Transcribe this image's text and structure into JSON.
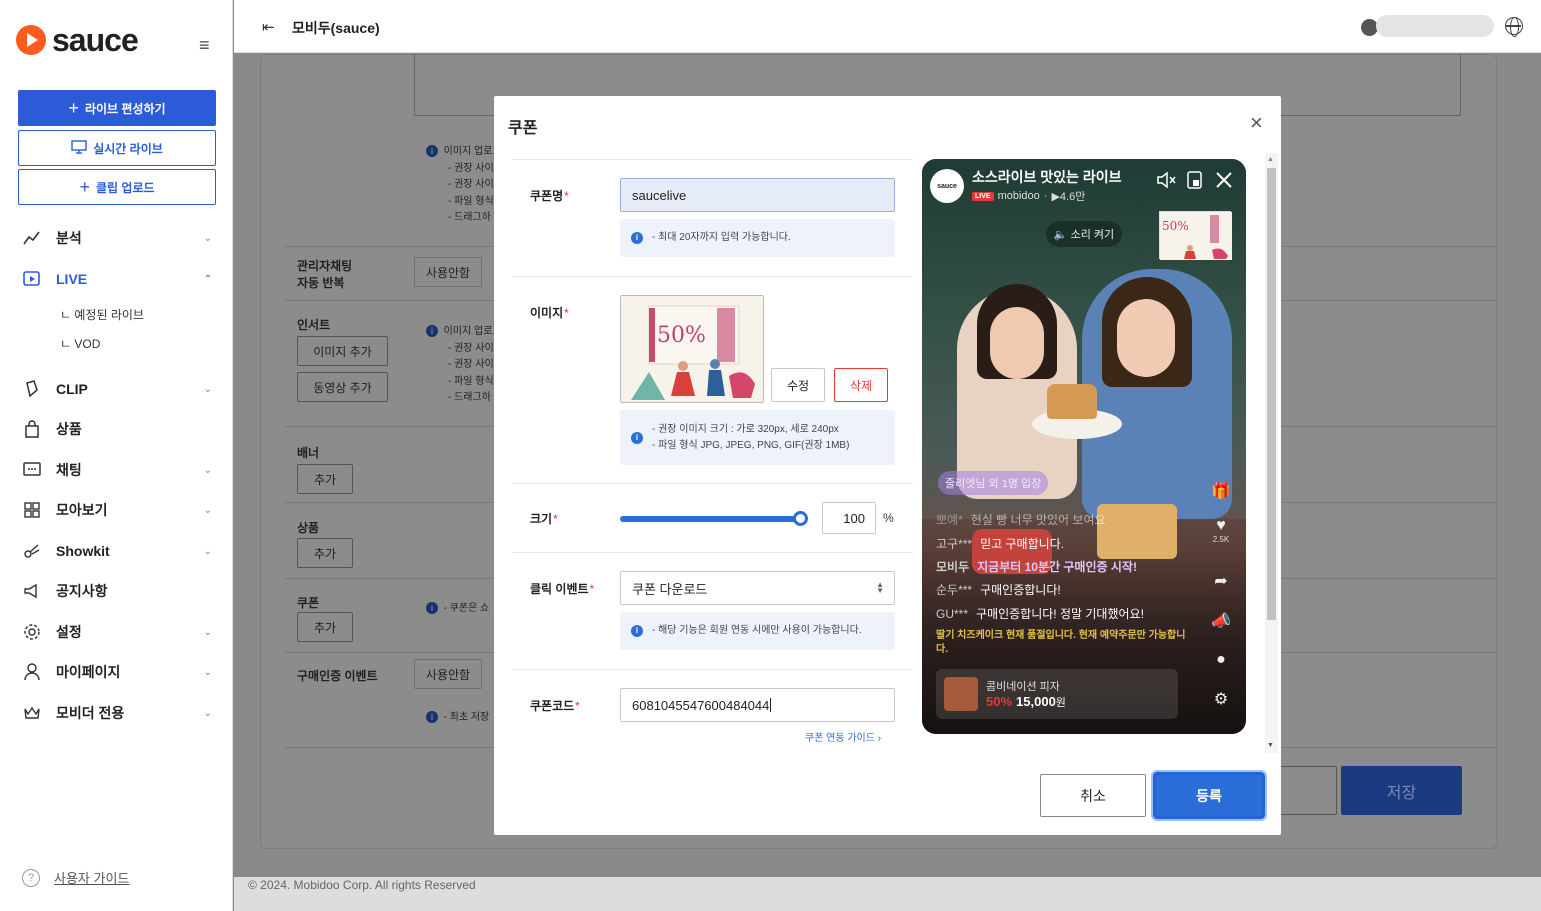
{
  "sidebar": {
    "logo_text": "sauce",
    "buttons": [
      {
        "label": "라이브 편성하기",
        "icon": "plus-icon"
      },
      {
        "label": "실시간 라이브",
        "icon": "monitor-icon"
      },
      {
        "label": "클립 업로드",
        "icon": "plus-icon"
      }
    ],
    "menu": [
      {
        "label": "분석",
        "icon": "analytics-icon"
      },
      {
        "label": "LIVE",
        "icon": "live-play-icon"
      },
      {
        "label": "CLIP",
        "icon": "clip-icon"
      },
      {
        "label": "상품",
        "icon": "bag-icon"
      },
      {
        "label": "채팅",
        "icon": "chat-icon"
      },
      {
        "label": "모아보기",
        "icon": "grid-icon"
      },
      {
        "label": "Showkit",
        "icon": "showkit-icon"
      },
      {
        "label": "공지사항",
        "icon": "megaphone-icon"
      },
      {
        "label": "설정",
        "icon": "gear-icon"
      },
      {
        "label": "마이페이지",
        "icon": "user-icon"
      },
      {
        "label": "모비더 전용",
        "icon": "crown-icon"
      }
    ],
    "submenu": [
      "ㄴ  예정된 라이브",
      "ㄴ  VOD"
    ],
    "guide_label": "사용자 가이드"
  },
  "topbar": {
    "title": "모비두(sauce)"
  },
  "background": {
    "labels": {
      "admin_chat": "관리자채팅",
      "auto_repeat": "자동 반복",
      "insert": "인서트",
      "banner": "배너",
      "product": "상품",
      "coupon": "쿠폰",
      "purchase_event": "구매인증 이벤트"
    },
    "buttons": {
      "add_image": "이미지 추가",
      "add_video": "동영상 추가",
      "add": "추가",
      "unused": "사용안함",
      "save": "저장"
    },
    "info_lines": [
      "이미지 업로드",
      "- 권장 사이",
      "- 권장 사이",
      "- 파일 형식",
      "- 드래그하"
    ],
    "coupon_info": "- 쿠폰은 쇼",
    "first_info": "- 최초 저장"
  },
  "footer": {
    "copyright": "© 2024. Mobidoo Corp. All rights Reserved"
  },
  "modal": {
    "title": "쿠폰",
    "coupon_name": {
      "label": "쿠폰명",
      "value": "saucelive",
      "info": "- 최대 20자까지 입력 가능합니다."
    },
    "image": {
      "label": "이미지",
      "edit": "수정",
      "delete": "삭제",
      "info": [
        "- 권장 이미지 크기 : 가로 320px, 세로 240px",
        "- 파일 형식 JPG, JPEG, PNG, GIF(권장 1MB)"
      ],
      "thumb_text": "50%"
    },
    "size": {
      "label": "크기",
      "value": "100",
      "unit": "%",
      "level": 1.0
    },
    "click_event": {
      "label": "클릭 이벤트",
      "value": "쿠폰 다운로드",
      "info": "- 해당 기능은 회원 연동 시에만 사용이 가능합니다."
    },
    "coupon_code": {
      "label": "쿠폰코드",
      "value": "6081045547600484044",
      "guide_link": "쿠폰 연동 가이드"
    },
    "cancel": "취소",
    "submit": "등록"
  },
  "preview": {
    "title": "소스라이브 맛있는 라이브",
    "channel": "mobidoo",
    "views": "▶4.6만",
    "live_badge": "LIVE",
    "avatar_text": "sauce",
    "sound_toggle": "소리 켜기",
    "enter_msg": "줄리엣님 외 1명 입장",
    "chats": [
      {
        "user": "뽀예*",
        "text": "현실 빵 너무 맛있어 보여요"
      },
      {
        "user": "고구***",
        "text": "믿고 구매합니다."
      },
      {
        "user": "모비두",
        "text": "지금부터 10분간 구매인증 시작!"
      },
      {
        "user": "순두***",
        "text": "구매인증합니다!"
      },
      {
        "user": "GU***",
        "text": "구매인증합니다! 정말 기대했어요!"
      }
    ],
    "notice": "딸기 치즈케이크 현재 품절입니다. 현재 예약주문만 가능합니다.",
    "product": {
      "name": "콤비네이션 피자",
      "discount": "50%",
      "price": "15,000",
      "currency": "원"
    },
    "likes": "2.5K"
  }
}
